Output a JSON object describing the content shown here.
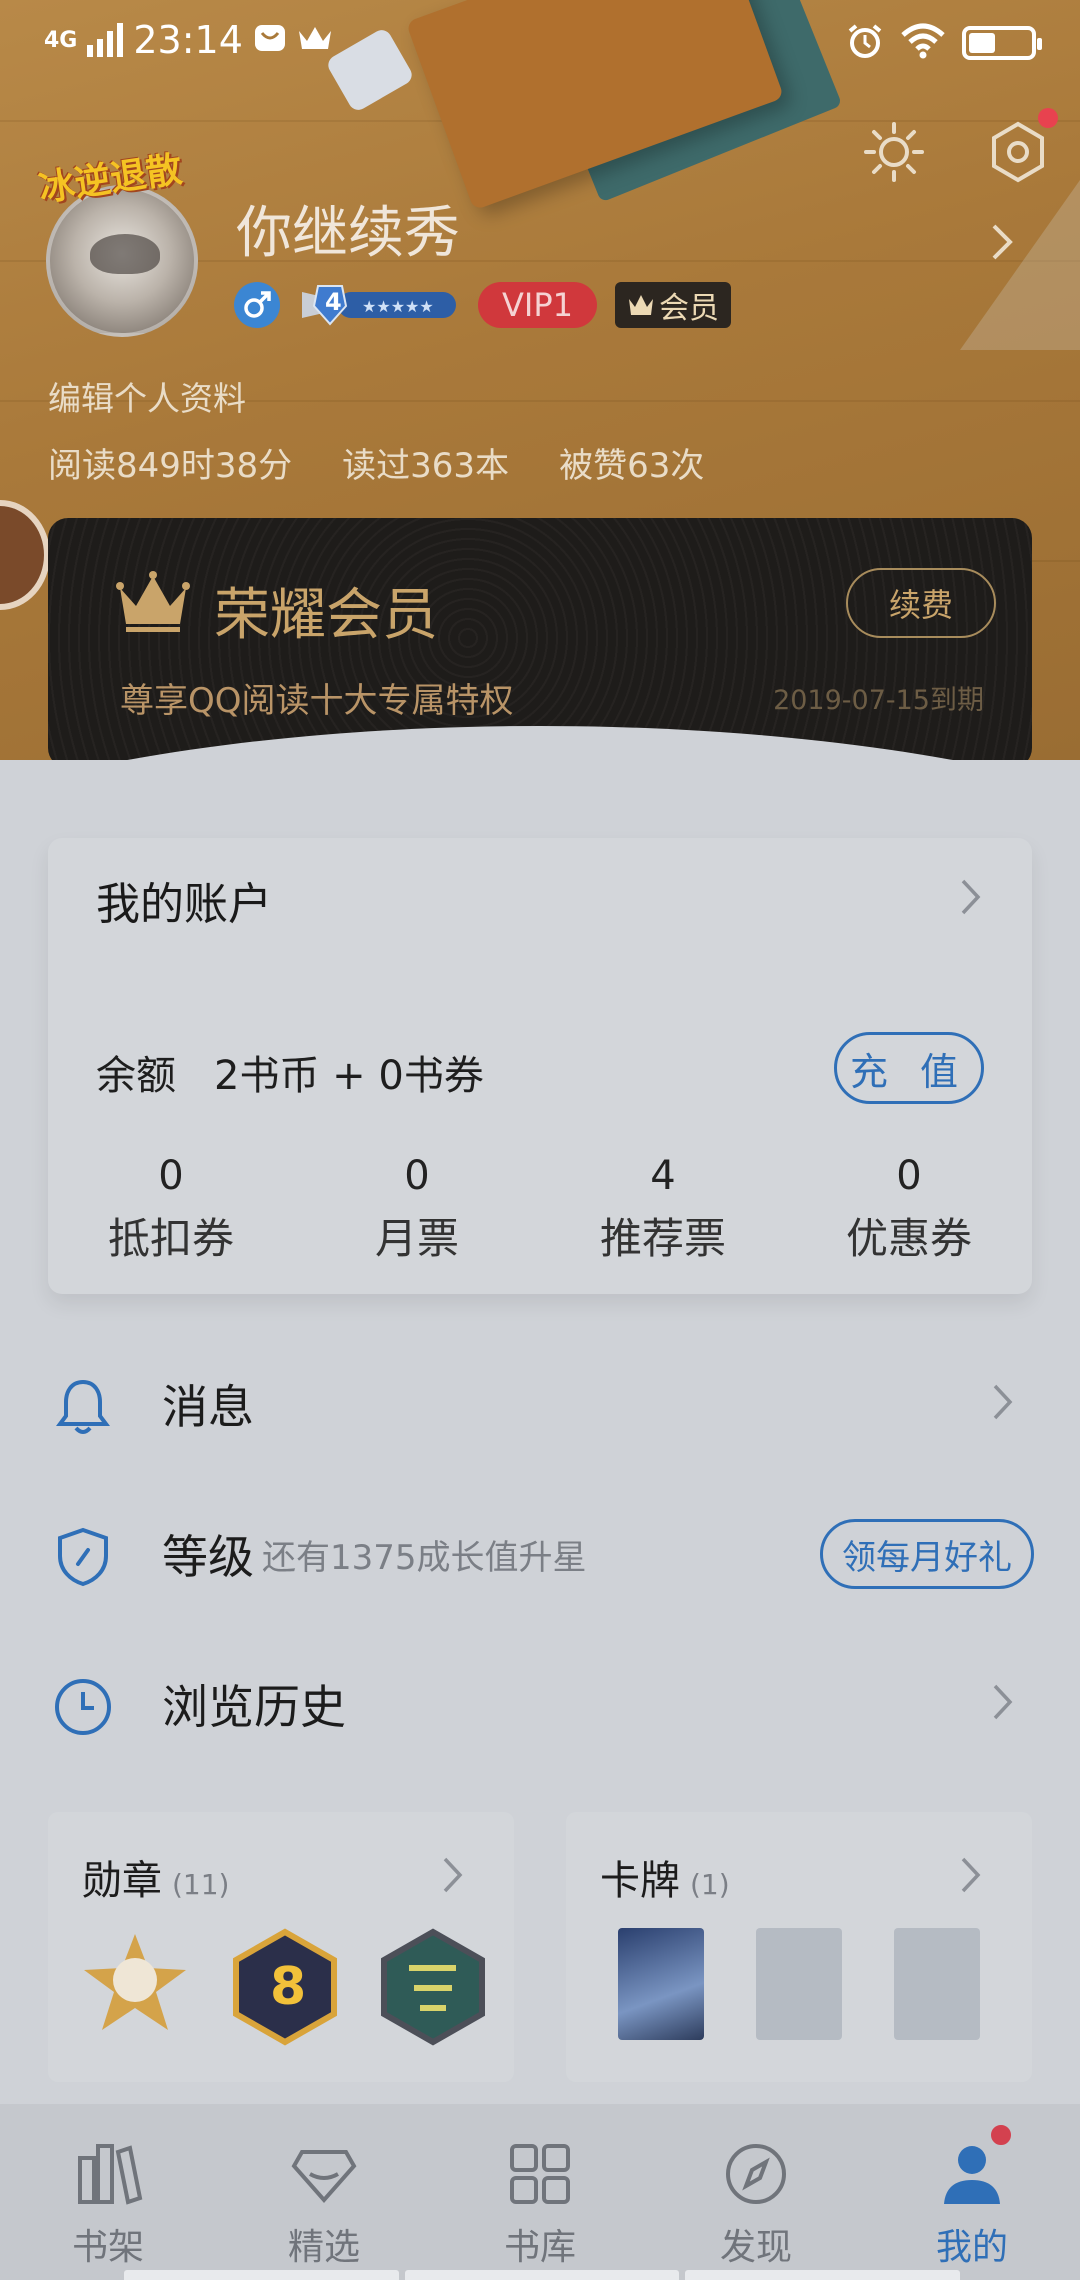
{
  "status_bar": {
    "network": "4G",
    "time": "23:14"
  },
  "profile": {
    "avatar_tag": "冰逆退散",
    "username": "你继续秀",
    "level": "4",
    "vip_label": "VIP1",
    "member_label": "会员",
    "edit_label": "编辑个人资料",
    "stats": [
      "阅读849时38分",
      "读过363本",
      "被赞63次"
    ]
  },
  "vip_card": {
    "title": "荣耀会员",
    "renew_label": "续费",
    "description": "尊享QQ阅读十大专属特权",
    "expiry": "2019-07-15到期"
  },
  "account": {
    "title": "我的账户",
    "balance_label": "余额",
    "balance_value": "2书币 + 0书券",
    "recharge_label": "充 值",
    "counters": [
      {
        "value": "0",
        "label": "抵扣券"
      },
      {
        "value": "0",
        "label": "月票"
      },
      {
        "value": "4",
        "label": "推荐票"
      },
      {
        "value": "0",
        "label": "优惠券"
      }
    ]
  },
  "menu": {
    "messages": "消息",
    "level": "等级",
    "level_sub": "还有1375成长值升星",
    "gift_label": "领每月好礼",
    "history": "浏览历史"
  },
  "medals": {
    "title": "勋章",
    "count": "(11)"
  },
  "cards": {
    "title": "卡牌",
    "count": "(1)"
  },
  "tabs": [
    {
      "label": "书架",
      "icon": "bookshelf-icon"
    },
    {
      "label": "精选",
      "icon": "diamond-icon"
    },
    {
      "label": "书库",
      "icon": "grid-icon"
    },
    {
      "label": "发现",
      "icon": "compass-icon"
    },
    {
      "label": "我的",
      "icon": "person-icon"
    }
  ],
  "colors": {
    "accent": "#2f6fb7",
    "vip_gold": "#c9a46a",
    "badge_red": "#d0383c"
  }
}
